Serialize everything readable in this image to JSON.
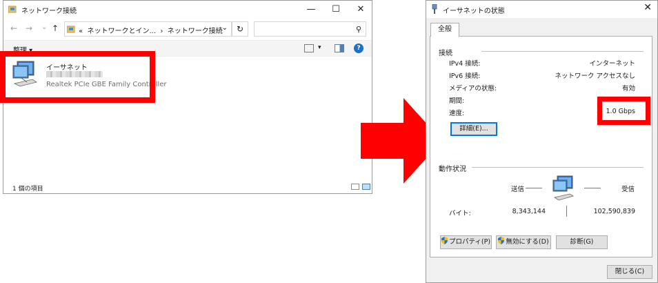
{
  "explorer": {
    "title": "ネットワーク接続",
    "nav": {
      "back": "←",
      "forward": "→",
      "dropdown": "⌄",
      "up": "↑"
    },
    "address": {
      "prefix": "«",
      "crumb1": "ネットワークとイン...",
      "sep": "›",
      "crumb2": "ネットワーク接続"
    },
    "organize_label": "整理 ▾",
    "adapter": {
      "name": "イーサネット",
      "description": "Realtek PCIe GBE Family Controller"
    },
    "status_text": "1 個の項目"
  },
  "dialog": {
    "title": "イーサネットの状態",
    "tab_label": "全般",
    "connection": {
      "header": "接続",
      "rows": [
        {
          "label": "IPv4 接続:",
          "value": "インターネット"
        },
        {
          "label": "IPv6 接続:",
          "value": "ネットワーク アクセスなし"
        },
        {
          "label": "メディアの状態:",
          "value": "有効"
        },
        {
          "label": "期間:",
          "value": ""
        },
        {
          "label": "速度:",
          "value": "1.0 Gbps"
        }
      ],
      "details_button": "詳細(E)..."
    },
    "activity": {
      "header": "動作状況",
      "sent_label": "送信",
      "received_label": "受信",
      "bytes_label": "バイト:",
      "bytes_sent": "8,343,144",
      "bytes_received": "102,590,839"
    },
    "buttons": {
      "properties": "プロパティ(P)",
      "disable": "無効にする(D)",
      "diagnose": "診断(G)",
      "close": "閉じる(C)"
    }
  },
  "colors": {
    "highlight": "#ff0000",
    "arrow": "#ff0000",
    "accent": "#0078d7"
  },
  "icons": [
    "network-folder-icon",
    "ethernet-adapter-icon",
    "network-computer-icon",
    "shield-icon",
    "help-icon"
  ]
}
